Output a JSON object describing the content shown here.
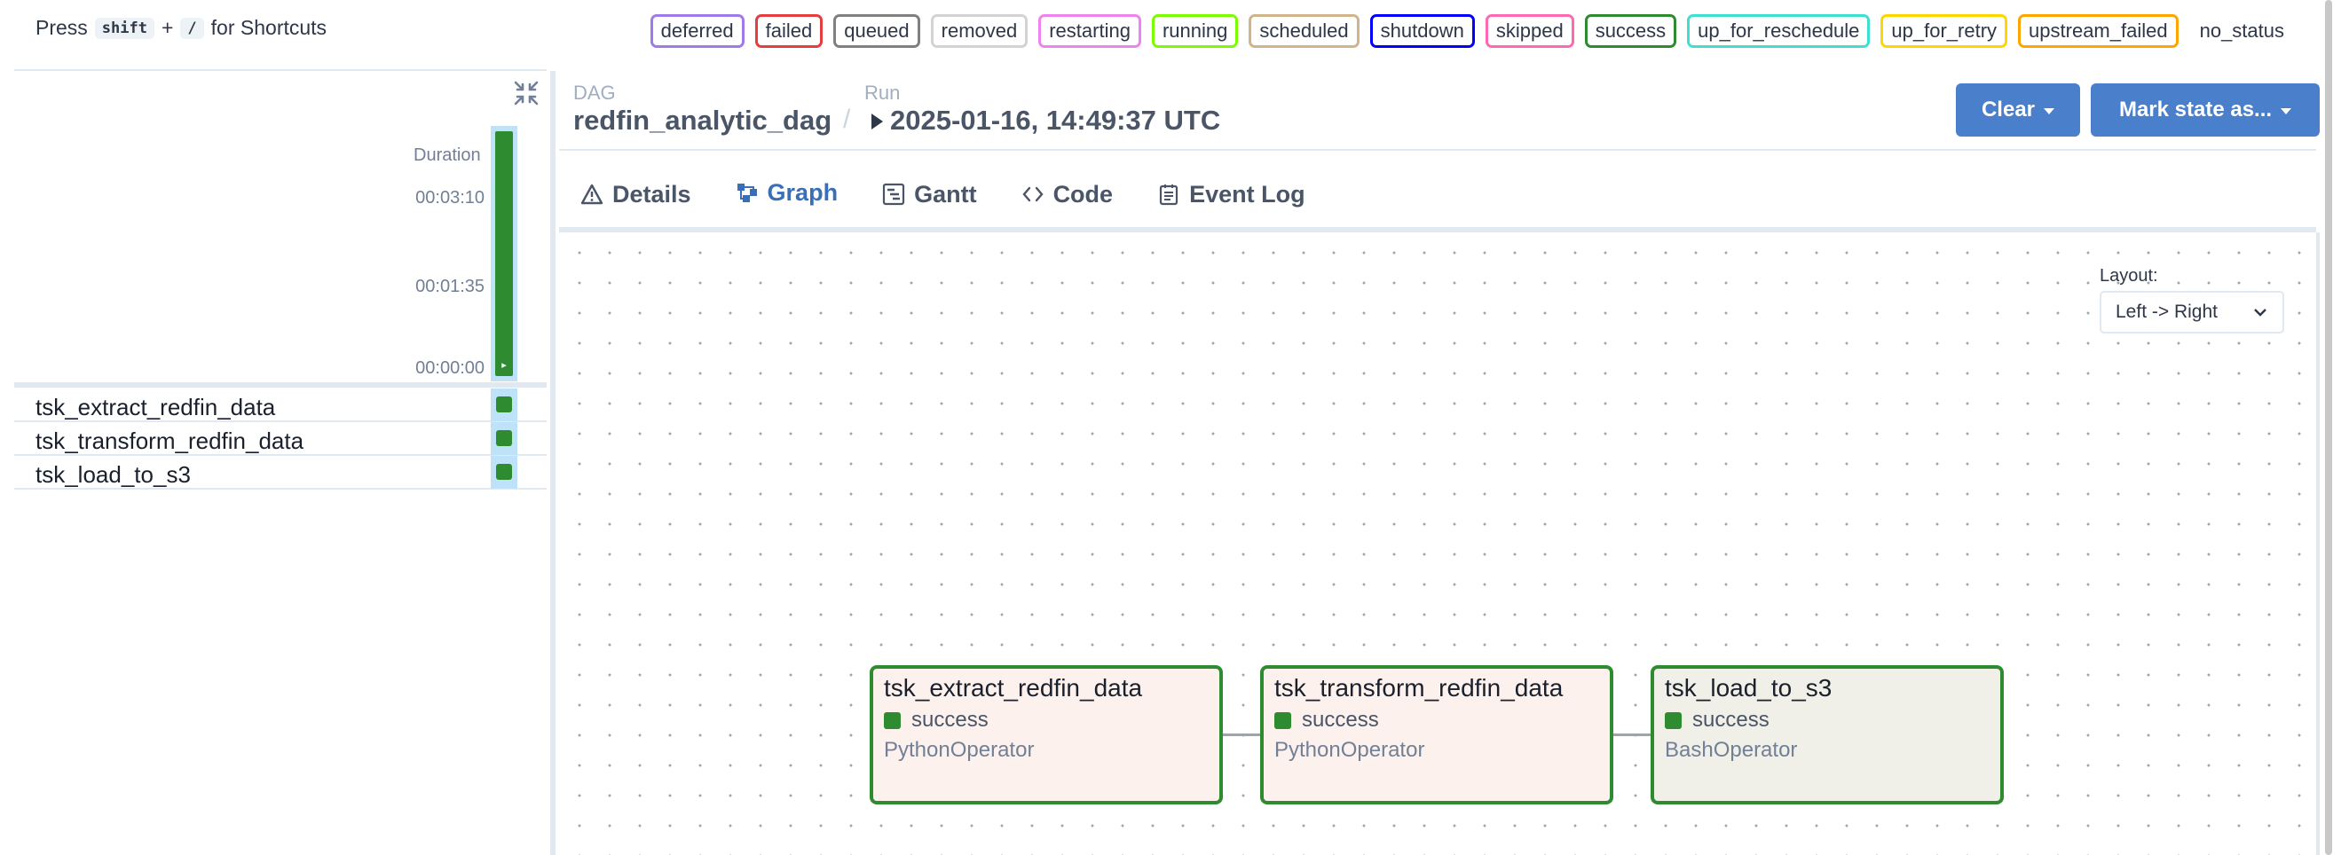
{
  "shortcuts": {
    "press": "Press",
    "key1": "shift",
    "plus": "+",
    "key2": "/",
    "suffix": "for Shortcuts"
  },
  "legend": [
    {
      "label": "deferred",
      "color": "#9f7aea"
    },
    {
      "label": "failed",
      "color": "#e53e3e"
    },
    {
      "label": "queued",
      "color": "#808080"
    },
    {
      "label": "removed",
      "color": "#d3d3d3"
    },
    {
      "label": "restarting",
      "color": "#ee82ee"
    },
    {
      "label": "running",
      "color": "#7cfc00"
    },
    {
      "label": "scheduled",
      "color": "#d2b48c"
    },
    {
      "label": "shutdown",
      "color": "#0000ff"
    },
    {
      "label": "skipped",
      "color": "#ff69b4"
    },
    {
      "label": "success",
      "color": "#2f8b2f"
    },
    {
      "label": "up_for_reschedule",
      "color": "#40e0d0"
    },
    {
      "label": "up_for_retry",
      "color": "#ffd700"
    },
    {
      "label": "upstream_failed",
      "color": "#ffa500"
    },
    {
      "label": "no_status",
      "color": "transparent"
    }
  ],
  "grid": {
    "duration_label": "Duration",
    "ticks": [
      "00:03:10",
      "00:01:35",
      "00:00:00"
    ],
    "run_duration_fraction": 1.0,
    "tasks": [
      {
        "name": "tsk_extract_redfin_data",
        "state": "success"
      },
      {
        "name": "tsk_transform_redfin_data",
        "state": "success"
      },
      {
        "name": "tsk_load_to_s3",
        "state": "success"
      }
    ]
  },
  "header": {
    "dag_label": "DAG",
    "dag_name": "redfin_analytic_dag",
    "separator": "/",
    "run_label": "Run",
    "run_value": "2025-01-16, 14:49:37 UTC",
    "clear_button": "Clear",
    "mark_state_button": "Mark state as..."
  },
  "tabs": [
    {
      "label": "Details",
      "icon": "warning-icon",
      "active": false
    },
    {
      "label": "Graph",
      "icon": "graph-icon",
      "active": true
    },
    {
      "label": "Gantt",
      "icon": "gantt-icon",
      "active": false
    },
    {
      "label": "Code",
      "icon": "code-icon",
      "active": false
    },
    {
      "label": "Event Log",
      "icon": "event-log-icon",
      "active": false
    }
  ],
  "graph": {
    "layout_label": "Layout:",
    "layout_value": "Left -> Right",
    "nodes": [
      {
        "name": "tsk_extract_redfin_data",
        "state": "success",
        "operator": "PythonOperator"
      },
      {
        "name": "tsk_transform_redfin_data",
        "state": "success",
        "operator": "PythonOperator"
      },
      {
        "name": "tsk_load_to_s3",
        "state": "success",
        "operator": "BashOperator"
      }
    ]
  }
}
